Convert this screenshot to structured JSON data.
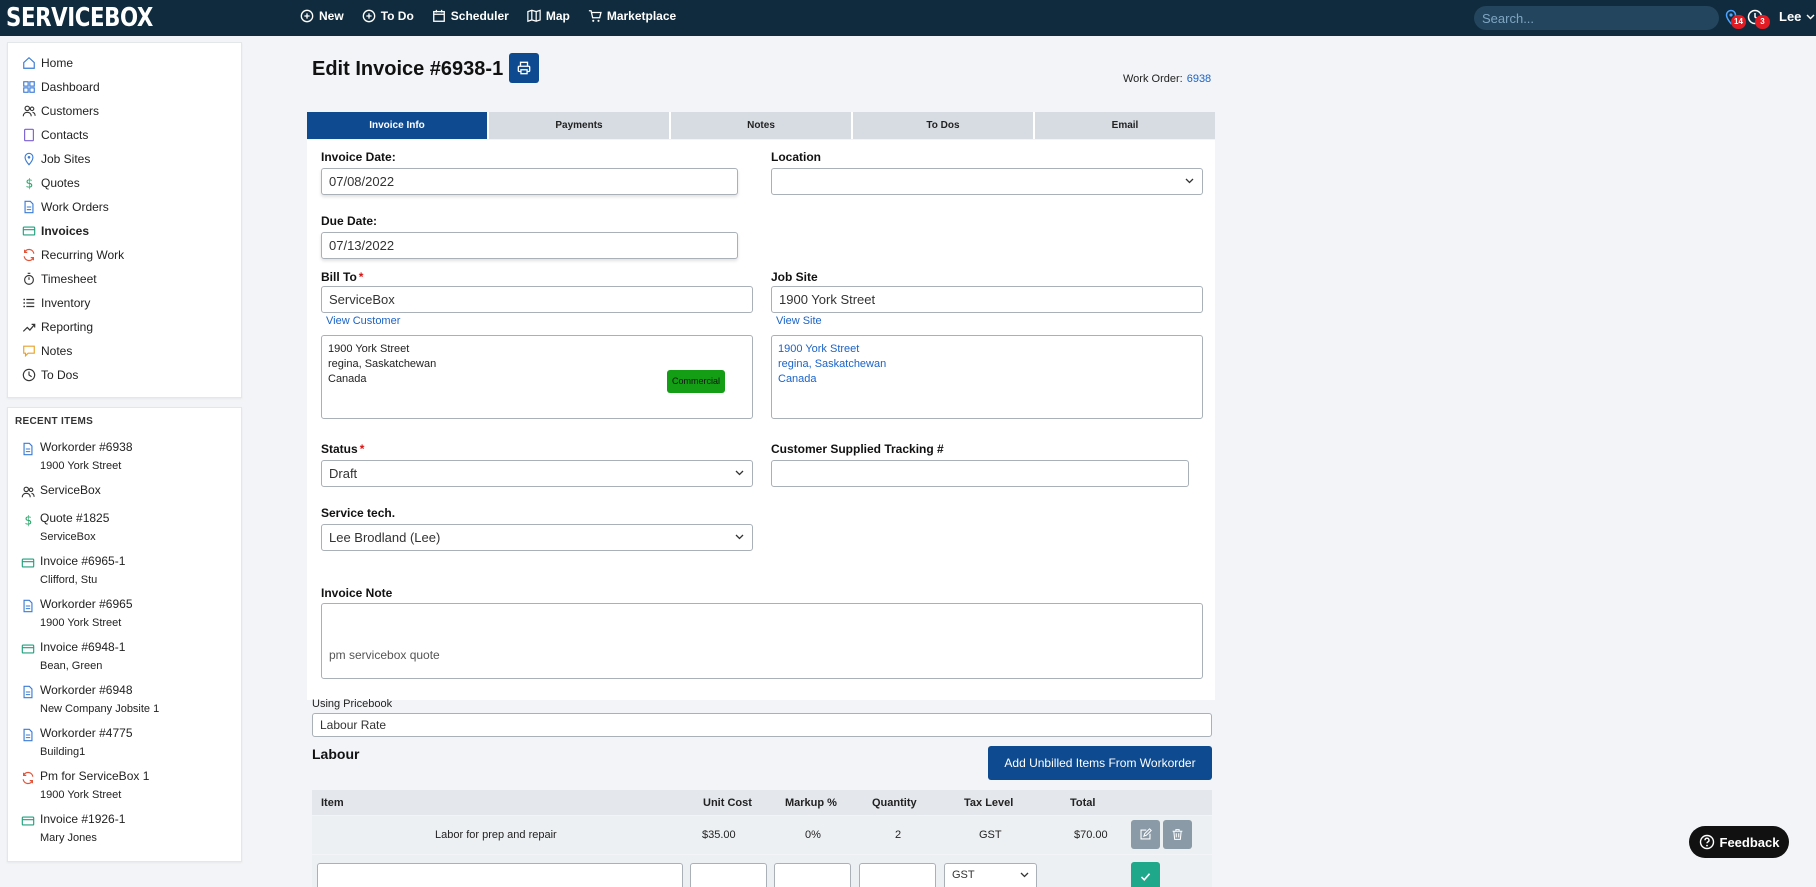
{
  "app": {
    "logo": "SERVICEBOX"
  },
  "topnav": [
    {
      "label": "New",
      "icon": "plus-circle-icon"
    },
    {
      "label": "To Do",
      "icon": "plus-circle-icon"
    },
    {
      "label": "Scheduler",
      "icon": "calendar-icon"
    },
    {
      "label": "Map",
      "icon": "map-icon"
    },
    {
      "label": "Marketplace",
      "icon": "cart-icon"
    }
  ],
  "search": {
    "placeholder": "Search..."
  },
  "notifications": {
    "location_count": "14",
    "clock_count": "3"
  },
  "user": {
    "name": "Lee"
  },
  "sidebar": {
    "items": [
      {
        "label": "Home",
        "icon": "home-icon"
      },
      {
        "label": "Dashboard",
        "icon": "dashboard-icon"
      },
      {
        "label": "Customers",
        "icon": "users-icon"
      },
      {
        "label": "Contacts",
        "icon": "contact-icon"
      },
      {
        "label": "Job Sites",
        "icon": "location-pin-icon"
      },
      {
        "label": "Quotes",
        "icon": "dollar-icon"
      },
      {
        "label": "Work Orders",
        "icon": "document-icon"
      },
      {
        "label": "Invoices",
        "icon": "invoice-icon"
      },
      {
        "label": "Recurring Work",
        "icon": "recurring-icon"
      },
      {
        "label": "Timesheet",
        "icon": "stopwatch-icon"
      },
      {
        "label": "Inventory",
        "icon": "list-icon"
      },
      {
        "label": "Reporting",
        "icon": "trend-icon"
      },
      {
        "label": "Notes",
        "icon": "note-icon"
      },
      {
        "label": "To Dos",
        "icon": "clock-icon"
      }
    ],
    "active": "Invoices"
  },
  "recent": {
    "title": "RECENT ITEMS",
    "items": [
      {
        "title": "Workorder #6938",
        "sub": "1900 York Street",
        "icon": "document-icon"
      },
      {
        "title": "ServiceBox",
        "sub": "",
        "icon": "users-icon"
      },
      {
        "title": "Quote #1825",
        "sub": "ServiceBox",
        "icon": "dollar-icon"
      },
      {
        "title": "Invoice #6965-1",
        "sub": "Clifford, Stu",
        "icon": "invoice-icon"
      },
      {
        "title": "Workorder #6965",
        "sub": "1900 York Street",
        "icon": "document-icon"
      },
      {
        "title": "Invoice #6948-1",
        "sub": "Bean, Green",
        "icon": "invoice-icon"
      },
      {
        "title": "Workorder #6948",
        "sub": "New Company Jobsite 1",
        "icon": "document-icon"
      },
      {
        "title": "Workorder #4775",
        "sub": "Building1",
        "icon": "document-icon"
      },
      {
        "title": "Pm for ServiceBox 1",
        "sub": "1900 York Street",
        "icon": "recurring-icon"
      },
      {
        "title": "Invoice #1926-1",
        "sub": "Mary Jones",
        "icon": "invoice-icon"
      }
    ]
  },
  "page": {
    "title": "Edit Invoice #6938-1",
    "workorder_label": "Work Order:",
    "workorder_value": "6938"
  },
  "tabs": [
    "Invoice Info",
    "Payments",
    "Notes",
    "To Dos",
    "Email"
  ],
  "form": {
    "invoice_date_label": "Invoice Date:",
    "invoice_date": "07/08/2022",
    "location_label": "Location",
    "location_value": "",
    "due_date_label": "Due Date:",
    "due_date": "07/13/2022",
    "bill_to_label": "Bill To",
    "bill_to": "ServiceBox",
    "view_customer": "View Customer",
    "bill_address": [
      "1900 York Street",
      "regina, Saskatchewan",
      "Canada"
    ],
    "commercial_badge": "Commercial",
    "job_site_label": "Job Site",
    "job_site": "1900 York Street",
    "view_site": "View Site",
    "site_address": [
      "1900 York Street",
      "regina, Saskatchewan",
      "Canada"
    ],
    "status_label": "Status",
    "status": "Draft",
    "tracking_label": "Customer Supplied Tracking #",
    "tracking": "",
    "service_tech_label": "Service tech.",
    "service_tech": "Lee Brodland (Lee)",
    "invoice_note_label": "Invoice Note",
    "invoice_note": "pm servicebox quote",
    "pricebook_label": "Using Pricebook",
    "pricebook": "Labour Rate"
  },
  "labour": {
    "title": "Labour",
    "add_button": "Add Unbilled Items From Workorder",
    "columns": [
      "Item",
      "Unit Cost",
      "Markup %",
      "Quantity",
      "Tax Level",
      "Total"
    ],
    "rows": [
      {
        "item": "Labor for prep and repair",
        "unit_cost": "$35.00",
        "markup": "0%",
        "quantity": "2",
        "tax": "GST",
        "total": "$70.00"
      }
    ],
    "new_row_tax": "GST"
  },
  "feedback": {
    "label": "Feedback"
  },
  "colors": {
    "topbar": "#0f2b3d",
    "primary": "#0e4a8f",
    "commercial": "#149e16",
    "badge": "#e41b23",
    "confirm": "#1fa88a"
  }
}
